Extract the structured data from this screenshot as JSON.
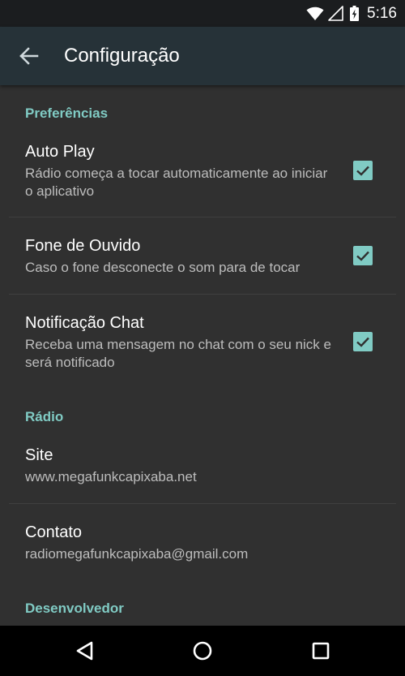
{
  "status_bar": {
    "time": "5:16",
    "icons": [
      "wifi-icon",
      "signal-icon",
      "battery-icon"
    ]
  },
  "app_bar": {
    "back_icon": "arrow-back-icon",
    "title": "Configuração"
  },
  "sections": {
    "preferences": {
      "header": "Preferências",
      "items": [
        {
          "title": "Auto Play",
          "summary": "Rádio começa a tocar automaticamente ao iniciar o aplicativo",
          "checked": true
        },
        {
          "title": "Fone de Ouvido",
          "summary": "Caso o fone desconecte o som para de tocar",
          "checked": true
        },
        {
          "title": "Notificação Chat",
          "summary": "Receba uma mensagem no chat com o seu nick e será notificado",
          "checked": true
        }
      ]
    },
    "radio": {
      "header": "Rádio",
      "items": [
        {
          "title": "Site",
          "summary": "www.megafunkcapixaba.net"
        },
        {
          "title": "Contato",
          "summary": "radiomegafunkcapixaba@gmail.com"
        }
      ]
    },
    "developer": {
      "header": "Desenvolvedor"
    }
  },
  "nav_bar": {
    "icons": [
      "back-triangle-icon",
      "home-circle-icon",
      "recents-square-icon"
    ]
  },
  "colors": {
    "accent": "#80cbc4",
    "app_bar": "#263238",
    "status_bar": "#1b1d1f",
    "background": "#303030",
    "summary_text": "#bdbdbd",
    "nav_bar": "#000000"
  }
}
